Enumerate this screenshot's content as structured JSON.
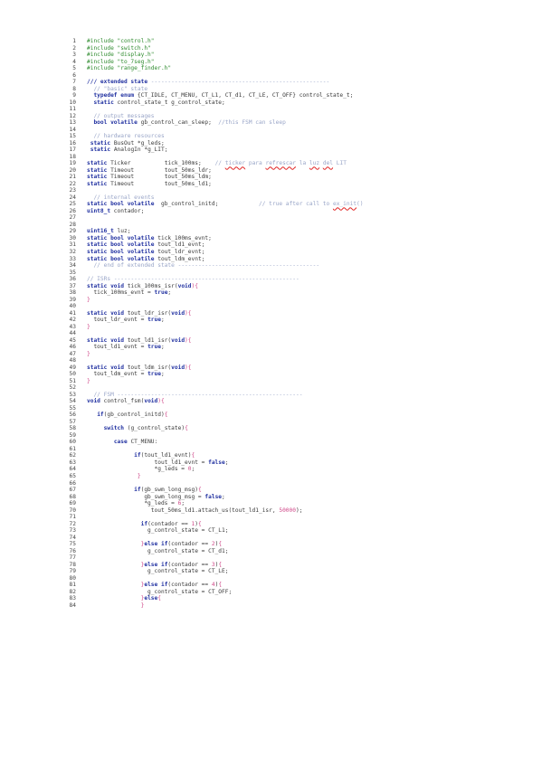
{
  "document": {
    "colors": {
      "background": "#ffffff",
      "text": "#3a3a3a",
      "line_number": "#444444",
      "preprocessor": "#2e8b2e",
      "comment": "#9aa6c8",
      "keyword": "#2030a0",
      "number": "#d04a8a",
      "spellcheck_underline": "#e02020"
    },
    "lines": [
      {
        "n": "1",
        "tokens": [
          {
            "t": "#include \"control.h\"",
            "c": "pp"
          }
        ]
      },
      {
        "n": "2",
        "tokens": [
          {
            "t": "#include \"switch.h\"",
            "c": "pp"
          }
        ]
      },
      {
        "n": "3",
        "tokens": [
          {
            "t": "#include \"display.h\"",
            "c": "pp"
          }
        ]
      },
      {
        "n": "4",
        "tokens": [
          {
            "t": "#include \"to_7seg.h\"",
            "c": "pp"
          }
        ]
      },
      {
        "n": "5",
        "tokens": [
          {
            "t": "#include \"range_finder.h\"",
            "c": "pp"
          }
        ]
      },
      {
        "n": "6",
        "tokens": []
      },
      {
        "n": "7",
        "tokens": [
          {
            "t": "/// extended state ",
            "c": "kw"
          },
          {
            "t": "-----------------------------------------------------",
            "c": "cm"
          }
        ]
      },
      {
        "n": "8",
        "tokens": [
          {
            "t": "  // \"basic\" state",
            "c": "cm"
          }
        ]
      },
      {
        "n": "9",
        "tokens": [
          {
            "t": "  ",
            "c": ""
          },
          {
            "t": "typedef enum",
            "c": "kw"
          },
          {
            "t": " {CT_IDLE, CT_MENU, CT_L1, CT_d1, CT_LE, CT_OFF} control_state_t;",
            "c": ""
          }
        ]
      },
      {
        "n": "10",
        "tokens": [
          {
            "t": "  ",
            "c": ""
          },
          {
            "t": "static",
            "c": "kw"
          },
          {
            "t": " control_state_t g_control_state;",
            "c": ""
          }
        ]
      },
      {
        "n": "11",
        "tokens": []
      },
      {
        "n": "12",
        "tokens": [
          {
            "t": "  // output messages",
            "c": "cm"
          }
        ]
      },
      {
        "n": "13",
        "tokens": [
          {
            "t": "  ",
            "c": ""
          },
          {
            "t": "bool volatile",
            "c": "kw"
          },
          {
            "t": " gb_control_can_sleep;  ",
            "c": ""
          },
          {
            "t": "//this FSM can sleep",
            "c": "cm"
          }
        ]
      },
      {
        "n": "14",
        "tokens": []
      },
      {
        "n": "15",
        "tokens": [
          {
            "t": "  // hardware resources",
            "c": "cm"
          }
        ]
      },
      {
        "n": "16",
        "tokens": [
          {
            "t": " ",
            "c": ""
          },
          {
            "t": "static",
            "c": "kw"
          },
          {
            "t": " BusOut *g_leds;",
            "c": ""
          }
        ]
      },
      {
        "n": "17",
        "tokens": [
          {
            "t": " ",
            "c": ""
          },
          {
            "t": "static",
            "c": "kw"
          },
          {
            "t": " AnalogIn *g_LIT;",
            "c": ""
          }
        ]
      },
      {
        "n": "18",
        "tokens": []
      },
      {
        "n": "19",
        "tokens": [
          {
            "t": "static",
            "c": "kw"
          },
          {
            "t": " Ticker          tick_100ms;    ",
            "c": ""
          },
          {
            "t": "// ",
            "c": "cm"
          },
          {
            "t": "ticker",
            "c": "cmsq"
          },
          {
            "t": " para ",
            "c": "cm"
          },
          {
            "t": "refrescar",
            "c": "cmsq"
          },
          {
            "t": " la ",
            "c": "cm"
          },
          {
            "t": "luz",
            "c": "cmsq"
          },
          {
            "t": " ",
            "c": "cm"
          },
          {
            "t": "del",
            "c": "cmsq"
          },
          {
            "t": " LIT",
            "c": "cm"
          }
        ]
      },
      {
        "n": "20",
        "tokens": [
          {
            "t": "static",
            "c": "kw"
          },
          {
            "t": " Timeout         tout_50ms_ldr;",
            "c": ""
          }
        ]
      },
      {
        "n": "21",
        "tokens": [
          {
            "t": "static",
            "c": "kw"
          },
          {
            "t": " Timeout         tout_50ms_ldm;",
            "c": ""
          }
        ]
      },
      {
        "n": "22",
        "tokens": [
          {
            "t": "static",
            "c": "kw"
          },
          {
            "t": " Timeout         tout_50ms_ld1;",
            "c": ""
          }
        ]
      },
      {
        "n": "23",
        "tokens": []
      },
      {
        "n": "24",
        "tokens": [
          {
            "t": "  // internal events",
            "c": "cm"
          }
        ]
      },
      {
        "n": "25",
        "tokens": [
          {
            "t": "static bool volatile",
            "c": "kw"
          },
          {
            "t": "  gb_control_initd;            ",
            "c": ""
          },
          {
            "t": "// true after call to ",
            "c": "cm"
          },
          {
            "t": "ex_init",
            "c": "cmsq"
          },
          {
            "t": "()",
            "c": "cm"
          }
        ]
      },
      {
        "n": "26",
        "tokens": [
          {
            "t": "uint8_t",
            "c": "kw"
          },
          {
            "t": " contador;",
            "c": ""
          }
        ]
      },
      {
        "n": "27",
        "tokens": []
      },
      {
        "n": "28",
        "tokens": []
      },
      {
        "n": "29",
        "tokens": [
          {
            "t": "uint16_t",
            "c": "kw"
          },
          {
            "t": " luz;",
            "c": ""
          }
        ]
      },
      {
        "n": "30",
        "tokens": [
          {
            "t": "static bool volatile",
            "c": "kw"
          },
          {
            "t": " tick_100ms_evnt;",
            "c": ""
          }
        ]
      },
      {
        "n": "31",
        "tokens": [
          {
            "t": "static bool volatile",
            "c": "kw"
          },
          {
            "t": " tout_ld1_evnt;",
            "c": ""
          }
        ]
      },
      {
        "n": "32",
        "tokens": [
          {
            "t": "static bool volatile",
            "c": "kw"
          },
          {
            "t": " tout_ldr_evnt;",
            "c": ""
          }
        ]
      },
      {
        "n": "33",
        "tokens": [
          {
            "t": "static bool volatile",
            "c": "kw"
          },
          {
            "t": " tout_ldm_evnt;",
            "c": ""
          }
        ]
      },
      {
        "n": "34",
        "tokens": [
          {
            "t": "  // end of extended state ",
            "c": "cm"
          },
          {
            "t": "------------------------------------------",
            "c": "cm"
          }
        ]
      },
      {
        "n": "35",
        "tokens": []
      },
      {
        "n": "36",
        "tokens": [
          {
            "t": "// ISRs ",
            "c": "cm"
          },
          {
            "t": "-------------------------------------------------------",
            "c": "cm"
          }
        ]
      },
      {
        "n": "37",
        "tokens": [
          {
            "t": "static void",
            "c": "kw"
          },
          {
            "t": " tick_100ms_isr(",
            "c": ""
          },
          {
            "t": "void",
            "c": "kw"
          },
          {
            "t": "){",
            "c": "br"
          }
        ]
      },
      {
        "n": "38",
        "tokens": [
          {
            "t": "  tick_100ms_evnt = ",
            "c": ""
          },
          {
            "t": "true",
            "c": "kw"
          },
          {
            "t": ";",
            "c": ""
          }
        ]
      },
      {
        "n": "39",
        "tokens": [
          {
            "t": "}",
            "c": "br"
          }
        ]
      },
      {
        "n": "40",
        "tokens": []
      },
      {
        "n": "41",
        "tokens": [
          {
            "t": "static void",
            "c": "kw"
          },
          {
            "t": " tout_ldr_isr(",
            "c": ""
          },
          {
            "t": "void",
            "c": "kw"
          },
          {
            "t": "){",
            "c": "br"
          }
        ]
      },
      {
        "n": "42",
        "tokens": [
          {
            "t": "  tout_ldr_evnt = ",
            "c": ""
          },
          {
            "t": "true",
            "c": "kw"
          },
          {
            "t": ";",
            "c": ""
          }
        ]
      },
      {
        "n": "43",
        "tokens": [
          {
            "t": "}",
            "c": "br"
          }
        ]
      },
      {
        "n": "44",
        "tokens": []
      },
      {
        "n": "45",
        "tokens": [
          {
            "t": "static void",
            "c": "kw"
          },
          {
            "t": " tout_ld1_isr(",
            "c": ""
          },
          {
            "t": "void",
            "c": "kw"
          },
          {
            "t": "){",
            "c": "br"
          }
        ]
      },
      {
        "n": "46",
        "tokens": [
          {
            "t": "  tout_ld1_evnt = ",
            "c": ""
          },
          {
            "t": "true",
            "c": "kw"
          },
          {
            "t": ";",
            "c": ""
          }
        ]
      },
      {
        "n": "47",
        "tokens": [
          {
            "t": "}",
            "c": "br"
          }
        ]
      },
      {
        "n": "48",
        "tokens": []
      },
      {
        "n": "49",
        "tokens": [
          {
            "t": "static void",
            "c": "kw"
          },
          {
            "t": " tout_ldm_isr(",
            "c": ""
          },
          {
            "t": "void",
            "c": "kw"
          },
          {
            "t": "){",
            "c": "br"
          }
        ]
      },
      {
        "n": "50",
        "tokens": [
          {
            "t": "  tout_ldm_evnt = ",
            "c": ""
          },
          {
            "t": "true",
            "c": "kw"
          },
          {
            "t": ";",
            "c": ""
          }
        ]
      },
      {
        "n": "51",
        "tokens": [
          {
            "t": "}",
            "c": "br"
          }
        ]
      },
      {
        "n": "52",
        "tokens": []
      },
      {
        "n": "53",
        "tokens": [
          {
            "t": "  // FSM ",
            "c": "cm"
          },
          {
            "t": "-------------------------------------------------------",
            "c": "cm"
          }
        ]
      },
      {
        "n": "54",
        "tokens": [
          {
            "t": "void",
            "c": "kw"
          },
          {
            "t": " control_fsm(",
            "c": ""
          },
          {
            "t": "void",
            "c": "kw"
          },
          {
            "t": "){",
            "c": "br"
          }
        ]
      },
      {
        "n": "55",
        "tokens": []
      },
      {
        "n": "56",
        "tokens": [
          {
            "t": "   ",
            "c": ""
          },
          {
            "t": "if",
            "c": "kw"
          },
          {
            "t": "(gb_control_initd)",
            "c": ""
          },
          {
            "t": "{",
            "c": "br"
          }
        ]
      },
      {
        "n": "57",
        "tokens": []
      },
      {
        "n": "58",
        "tokens": [
          {
            "t": "     ",
            "c": ""
          },
          {
            "t": "switch",
            "c": "kw"
          },
          {
            "t": " (g_control_state)",
            "c": ""
          },
          {
            "t": "{",
            "c": "br"
          }
        ]
      },
      {
        "n": "59",
        "tokens": []
      },
      {
        "n": "60",
        "tokens": [
          {
            "t": "        ",
            "c": ""
          },
          {
            "t": "case",
            "c": "kw"
          },
          {
            "t": " CT_MENU:",
            "c": ""
          }
        ]
      },
      {
        "n": "61",
        "tokens": []
      },
      {
        "n": "62",
        "tokens": [
          {
            "t": "              ",
            "c": ""
          },
          {
            "t": "if",
            "c": "kw"
          },
          {
            "t": "(tout_ld1_evnt)",
            "c": ""
          },
          {
            "t": "{",
            "c": "br"
          }
        ]
      },
      {
        "n": "63",
        "tokens": [
          {
            "t": "                    tout_ld1_evnt = ",
            "c": ""
          },
          {
            "t": "false",
            "c": "kw"
          },
          {
            "t": ";",
            "c": ""
          }
        ]
      },
      {
        "n": "64",
        "tokens": [
          {
            "t": "                    *g_leds = ",
            "c": ""
          },
          {
            "t": "0",
            "c": "num"
          },
          {
            "t": ";",
            "c": ""
          }
        ]
      },
      {
        "n": "65",
        "tokens": [
          {
            "t": "               }",
            "c": "br"
          }
        ]
      },
      {
        "n": "66",
        "tokens": []
      },
      {
        "n": "67",
        "tokens": [
          {
            "t": "              ",
            "c": ""
          },
          {
            "t": "if",
            "c": "kw"
          },
          {
            "t": "(gb_swm_long_msg)",
            "c": ""
          },
          {
            "t": "{",
            "c": "br"
          }
        ]
      },
      {
        "n": "68",
        "tokens": [
          {
            "t": "                 gb_swm_long_msg = ",
            "c": ""
          },
          {
            "t": "false",
            "c": "kw"
          },
          {
            "t": ";",
            "c": ""
          }
        ]
      },
      {
        "n": "69",
        "tokens": [
          {
            "t": "                 *g_leds = ",
            "c": ""
          },
          {
            "t": "6",
            "c": "num"
          },
          {
            "t": ";",
            "c": ""
          }
        ]
      },
      {
        "n": "70",
        "tokens": [
          {
            "t": "                   tout_50ms_ld1.attach_us(tout_ld1_isr, ",
            "c": ""
          },
          {
            "t": "50000",
            "c": "num"
          },
          {
            "t": ");",
            "c": ""
          }
        ]
      },
      {
        "n": "71",
        "tokens": []
      },
      {
        "n": "72",
        "tokens": [
          {
            "t": "                ",
            "c": ""
          },
          {
            "t": "if",
            "c": "kw"
          },
          {
            "t": "(contador == ",
            "c": ""
          },
          {
            "t": "1",
            "c": "num"
          },
          {
            "t": ")",
            "c": ""
          },
          {
            "t": "{",
            "c": "br"
          }
        ]
      },
      {
        "n": "73",
        "tokens": [
          {
            "t": "                  g_control_state = CT_L1;",
            "c": ""
          }
        ]
      },
      {
        "n": "74",
        "tokens": []
      },
      {
        "n": "75",
        "tokens": [
          {
            "t": "                ",
            "c": ""
          },
          {
            "t": "}",
            "c": "br"
          },
          {
            "t": "else if",
            "c": "kw"
          },
          {
            "t": "(contador == ",
            "c": ""
          },
          {
            "t": "2",
            "c": "num"
          },
          {
            "t": ")",
            "c": ""
          },
          {
            "t": "{",
            "c": "br"
          }
        ]
      },
      {
        "n": "76",
        "tokens": [
          {
            "t": "                  g_control_state = CT_d1;",
            "c": ""
          }
        ]
      },
      {
        "n": "77",
        "tokens": []
      },
      {
        "n": "78",
        "tokens": [
          {
            "t": "                ",
            "c": ""
          },
          {
            "t": "}",
            "c": "br"
          },
          {
            "t": "else if",
            "c": "kw"
          },
          {
            "t": "(contador == ",
            "c": ""
          },
          {
            "t": "3",
            "c": "num"
          },
          {
            "t": ")",
            "c": ""
          },
          {
            "t": "{",
            "c": "br"
          }
        ]
      },
      {
        "n": "79",
        "tokens": [
          {
            "t": "                  g_control_state = CT_LE;",
            "c": ""
          }
        ]
      },
      {
        "n": "80",
        "tokens": []
      },
      {
        "n": "81",
        "tokens": [
          {
            "t": "                ",
            "c": ""
          },
          {
            "t": "}",
            "c": "br"
          },
          {
            "t": "else if",
            "c": "kw"
          },
          {
            "t": "(contador == ",
            "c": ""
          },
          {
            "t": "4",
            "c": "num"
          },
          {
            "t": ")",
            "c": ""
          },
          {
            "t": "{",
            "c": "br"
          }
        ]
      },
      {
        "n": "82",
        "tokens": [
          {
            "t": "                  g_control_state = CT_OFF;",
            "c": ""
          }
        ]
      },
      {
        "n": "83",
        "tokens": [
          {
            "t": "                ",
            "c": ""
          },
          {
            "t": "}",
            "c": "br"
          },
          {
            "t": "else",
            "c": "kw"
          },
          {
            "t": "{",
            "c": "br"
          }
        ]
      },
      {
        "n": "84",
        "tokens": [
          {
            "t": "                }",
            "c": "br"
          }
        ]
      }
    ]
  }
}
